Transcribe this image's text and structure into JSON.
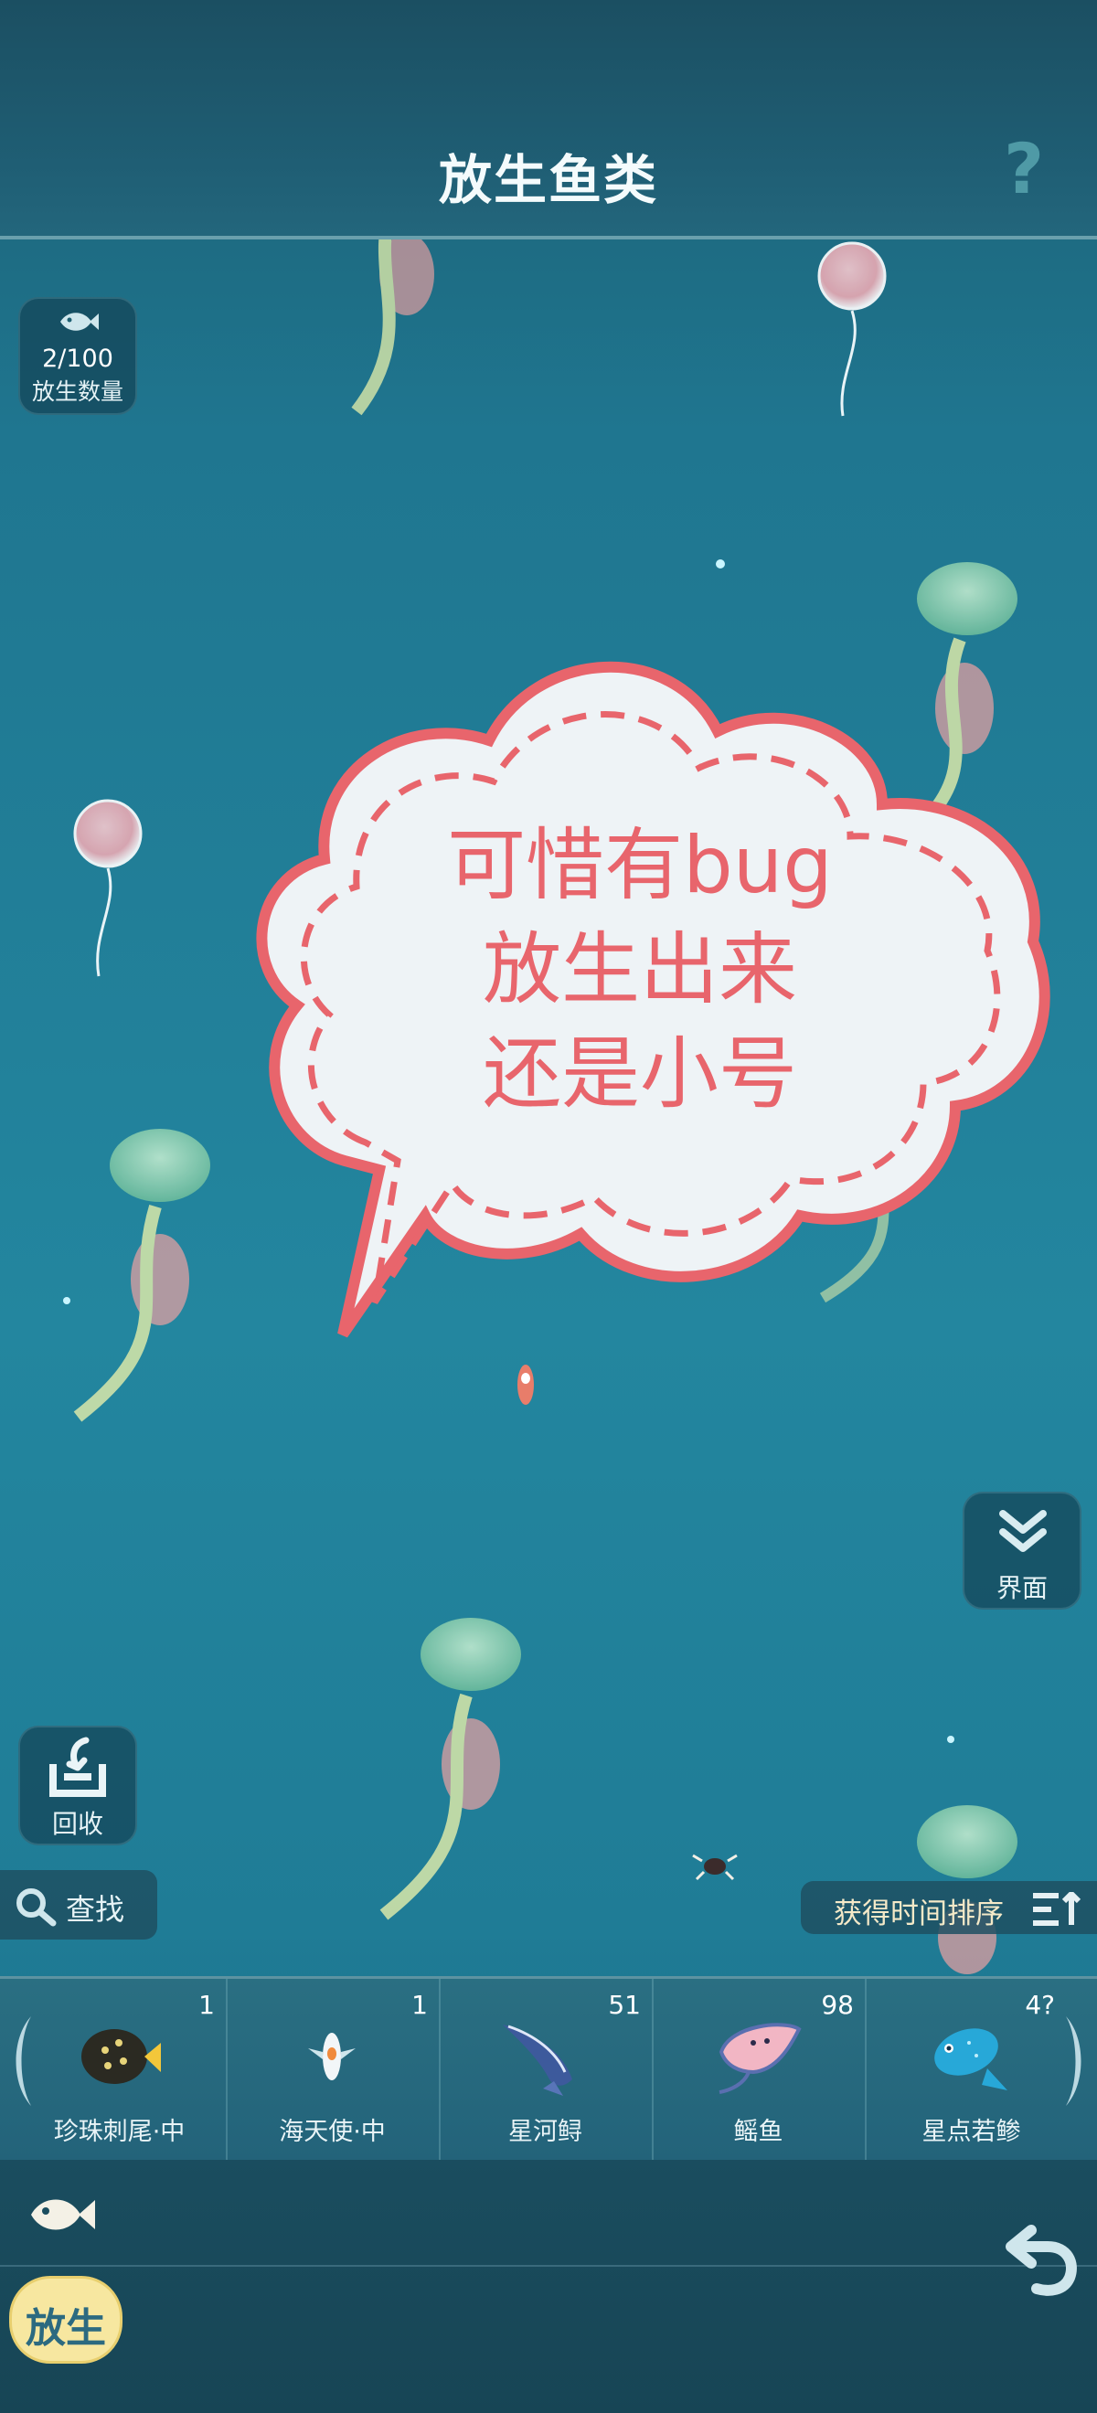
{
  "header": {
    "title": "放生鱼类",
    "help_label": "?"
  },
  "release_count": {
    "value": "2/100",
    "label": "放生数量",
    "icon": "fish-icon"
  },
  "speech_bubble": {
    "lines": [
      "可惜有bug",
      "放生出来",
      "还是小号"
    ],
    "color": "#e8656c"
  },
  "ui_toggle": {
    "label": "界面",
    "icon": "double-chevron-down-icon"
  },
  "recycle": {
    "label": "回收",
    "icon": "recycle-tray-icon"
  },
  "search": {
    "label": "查找",
    "icon": "search-icon"
  },
  "sort": {
    "label": "获得时间排序",
    "icon": "sort-icon"
  },
  "fish_list": [
    {
      "name": "珍珠刺尾·中",
      "count": "1"
    },
    {
      "name": "海天使·中",
      "count": "1"
    },
    {
      "name": "星河鲟",
      "count": "51"
    },
    {
      "name": "鳐鱼",
      "count": "98"
    },
    {
      "name": "星点若鲹",
      "count": "4?"
    }
  ],
  "bottom": {
    "release_mode_label": "放生",
    "back_icon": "back-arrow-icon",
    "fish_mode_icon": "fish-icon"
  },
  "colors": {
    "accent": "#e8656c",
    "bubble_fill": "#eef3f6",
    "sea": "#23869f"
  }
}
